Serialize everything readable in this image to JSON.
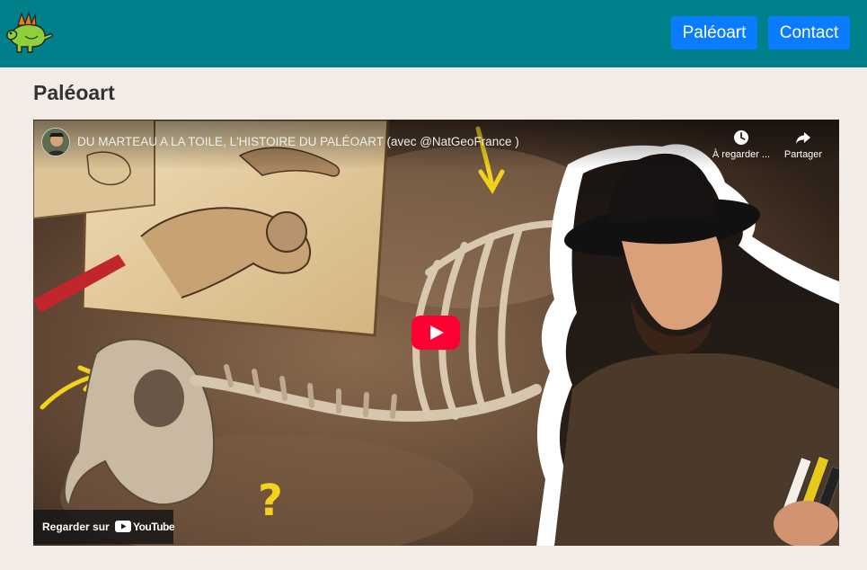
{
  "header": {
    "logo_icon": "dinosaur-icon",
    "nav": [
      {
        "label": "Paléoart"
      },
      {
        "label": "Contact"
      }
    ],
    "nav_color": "#0a7cff",
    "bar_color": "#00808b"
  },
  "main": {
    "title": "Paléoart"
  },
  "video": {
    "title": "DU MARTEAU A LA TOILE, L'HISTOIRE DU PALÉOART (avec @NatGeoFrance )",
    "watch_later_label": "À regarder ...",
    "share_label": "Partager",
    "watch_on_label": "Regarder sur",
    "platform_name": "YouTube",
    "play_icon": "play-icon",
    "watch_later_icon": "clock-icon",
    "share_icon": "share-arrow-icon"
  }
}
